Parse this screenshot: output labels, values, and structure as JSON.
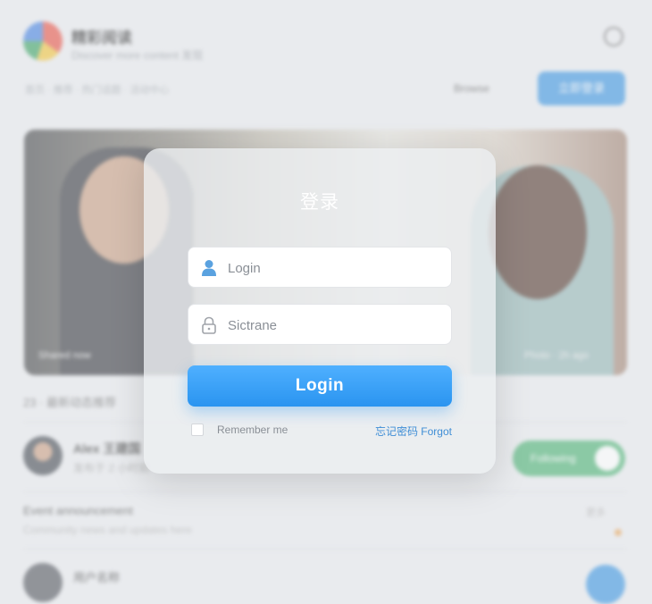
{
  "background": {
    "header": {
      "title": "精彩阅读",
      "subtitle": "Discover more content 发现",
      "nav_text": "首页 · 推荐 · 热门话题 · 活动中心",
      "link": "Browse",
      "button": "立即登录"
    },
    "photo": {
      "caption_left": "Shared now",
      "caption_right": "Photo · 2h ago"
    },
    "section_label": "23 · 最新动态推荐",
    "item1": {
      "name": "Alex 王建国",
      "meta": "发布于 2 小时前",
      "toggle_label": "Following"
    },
    "item2": {
      "title": "Event announcement",
      "subtitle": "Community news and updates here",
      "right": "更多"
    },
    "item3": {
      "name": "用户名称"
    }
  },
  "login": {
    "title": "登录",
    "username_placeholder": "Login",
    "password_placeholder": "Sictrane",
    "submit_label": "Login",
    "remember_label": "Remember me",
    "forgot_label": "忘记密码 Forgot"
  },
  "colors": {
    "accent": "#2f8fe0",
    "toggle": "#3fae6a"
  }
}
